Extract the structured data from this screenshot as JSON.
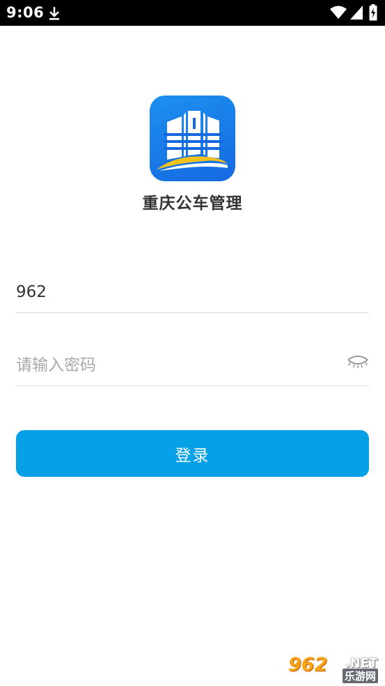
{
  "status_bar": {
    "time": "9:06",
    "icons": [
      "download-icon",
      "wifi-icon",
      "signal-icon",
      "battery-charging-icon"
    ]
  },
  "app": {
    "name": "重庆公车管理",
    "logo_colors": {
      "primary": "#1d8ff0",
      "accent": "#f5c21b"
    }
  },
  "form": {
    "username": {
      "value": "962",
      "placeholder": ""
    },
    "password": {
      "value": "",
      "placeholder": "请输入密码"
    },
    "login_label": "登录"
  },
  "watermark": {
    "number": "962",
    "suffix": ".NET",
    "site": "乐游网"
  },
  "colors": {
    "button": "#05a0e6",
    "divider": "#dcdcdc",
    "placeholder": "#a8a8a8"
  }
}
